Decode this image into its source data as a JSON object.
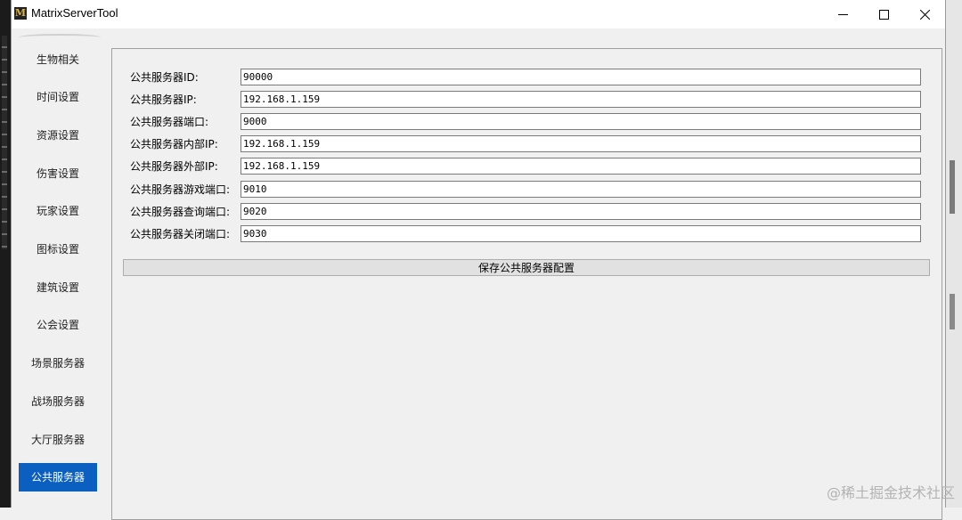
{
  "window": {
    "title": "MatrixServerTool",
    "icon_letter": "M"
  },
  "sidebar": {
    "items": [
      {
        "label": "生物相关"
      },
      {
        "label": "时间设置"
      },
      {
        "label": "资源设置"
      },
      {
        "label": "伤害设置"
      },
      {
        "label": "玩家设置"
      },
      {
        "label": "图标设置"
      },
      {
        "label": "建筑设置"
      },
      {
        "label": "公会设置"
      },
      {
        "label": "场景服务器"
      },
      {
        "label": "战场服务器"
      },
      {
        "label": "大厅服务器"
      },
      {
        "label": "公共服务器",
        "active": true
      }
    ]
  },
  "form": {
    "fields": [
      {
        "label": "公共服务器ID:",
        "value": "90000"
      },
      {
        "label": "公共服务器IP:",
        "value": "192.168.1.159"
      },
      {
        "label": "公共服务器端口:",
        "value": "9000"
      },
      {
        "label": "公共服务器内部IP:",
        "value": "192.168.1.159"
      },
      {
        "label": "公共服务器外部IP:",
        "value": "192.168.1.159"
      },
      {
        "label": "公共服务器游戏端口:",
        "value": "9010"
      },
      {
        "label": "公共服务器查询端口:",
        "value": "9020"
      },
      {
        "label": "公共服务器关闭端口:",
        "value": "9030"
      }
    ],
    "save_label": "保存公共服务器配置"
  },
  "watermark": "@稀土掘金技术社区",
  "colors": {
    "active_nav": "#0a5fc0"
  }
}
